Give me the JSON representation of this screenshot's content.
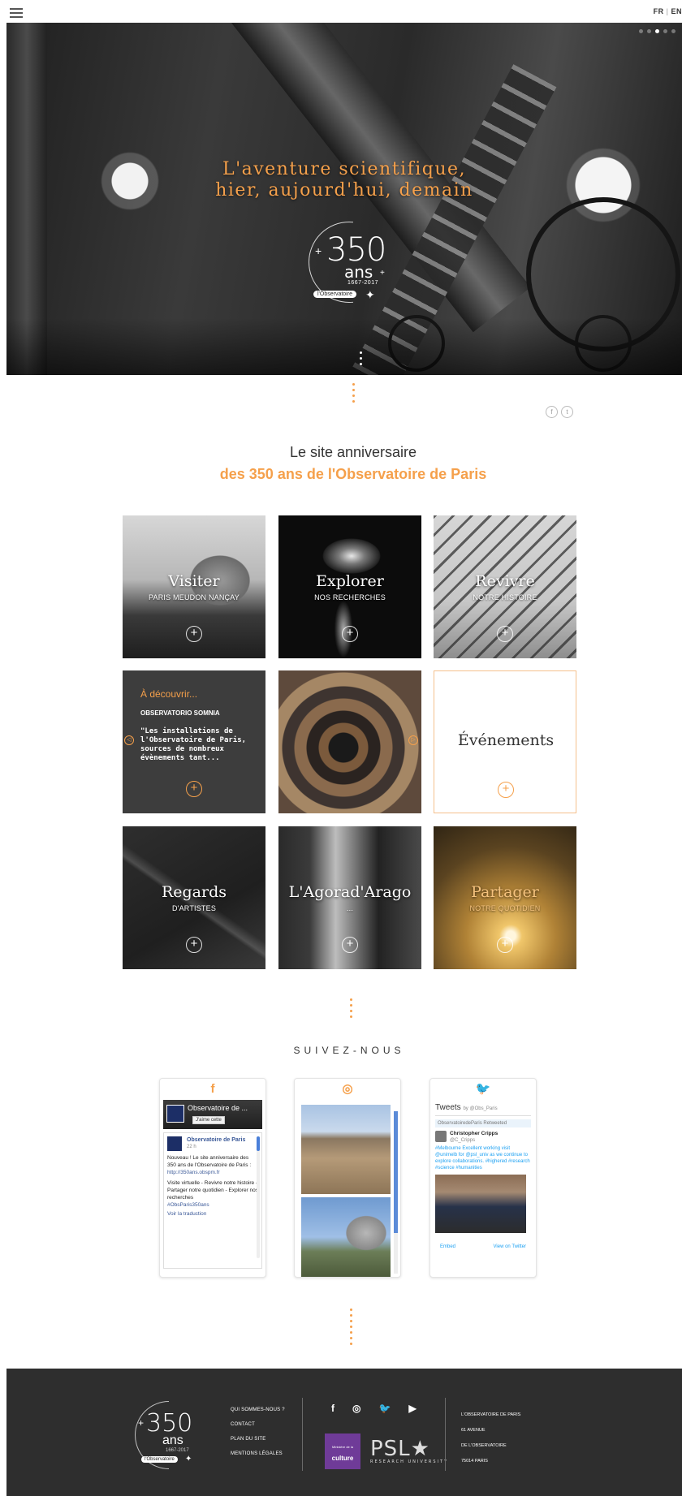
{
  "topbar": {
    "lang_fr": "FR",
    "lang_sep": "|",
    "lang_en": "EN"
  },
  "hero": {
    "title_line1": "L'aventure scientifique,",
    "title_line2": "hier, aujourd'hui, demain",
    "logo_number": "350",
    "logo_ans": "ans",
    "logo_years": "1667-2017",
    "logo_org": "l'Observatoire",
    "slide_count": 5,
    "active_slide": 3
  },
  "intro": {
    "line1": "Le site anniversaire",
    "line2": "des 350 ans de l'Observatoire de Paris"
  },
  "tiles": {
    "visiter": {
      "name": "Visiter",
      "sub": "PARIS MEUDON NANÇAY"
    },
    "explorer": {
      "name": "Explorer",
      "sub": "NOS RECHERCHES"
    },
    "revivre": {
      "name": "Revivre",
      "sub": "NOTRE HISTOIRE"
    },
    "decouvrir": {
      "title": "À découvrir...",
      "heading": "OBSERVATORIO SOMNIA",
      "text": "\"Les installations de l'Observatoire de Paris, sources de nombreux évènements tant..."
    },
    "evenements": {
      "name": "Événements"
    },
    "regards": {
      "name": "Regards",
      "sub": "D'ARTISTES"
    },
    "agora": {
      "name": "L'Agorad'Arago",
      "sub": "..."
    },
    "partager": {
      "name": "Partager",
      "sub": "NOTRE QUOTIDIEN"
    },
    "plus_symbol": "+"
  },
  "follow": {
    "title": "SUIVEZ-NOUS",
    "facebook": {
      "icon": "f",
      "page_name": "Observatoire de ...",
      "like_label": "J'aime cette",
      "post_author": "Observatoire de Paris",
      "post_time": "22 h",
      "post_text1": "Nouveau ! Le site anniversaire des 350 ans de l'Observatoire de Paris :",
      "post_link": "http://350ans.obspm.fr",
      "post_text2": "Visite virtuelle - Revivre notre histoire - Partager notre quotidien - Explorer nos recherches",
      "post_hashtag": "#ObsParis350ans",
      "post_translate": "Voir la traduction"
    },
    "instagram": {
      "icon": "◎"
    },
    "twitter": {
      "icon": "🐦",
      "heading": "Tweets",
      "by": "by @Obs_Paris",
      "retweet": "ObservatoiredeParis Retweeted",
      "author": "Christopher Cripps",
      "handle": "@C_Cripps",
      "text": "#Melbourne Excellent working visit @unimelb for @psl_univ as we continue to explore collaborations. #highered #research #science #humanities",
      "embed": "Embed",
      "view": "View on Twitter"
    }
  },
  "footer": {
    "logo_number": "350",
    "logo_ans": "ans",
    "logo_years": "1667-2017",
    "logo_org": "l'Observatoire",
    "links": [
      "QUI SOMMES-NOUS ?",
      "CONTACT",
      "PLAN DU SITE",
      "MENTIONS LÉGALES"
    ],
    "social": [
      "f",
      "◎",
      "🐦",
      "▶"
    ],
    "culture_small": "Ministère de la",
    "culture_name": "culture",
    "psl": "PSL★",
    "psl_sub": "RESEARCH UNIVERSITY",
    "address": [
      "L'OBSERVATOIRE DE PARIS",
      "61 AVENUE",
      "DE L'OBSERVATOIRE",
      "75014 PARIS"
    ]
  },
  "colors": {
    "accent": "#f5a04b",
    "footer_bg": "#2e2e2e"
  }
}
